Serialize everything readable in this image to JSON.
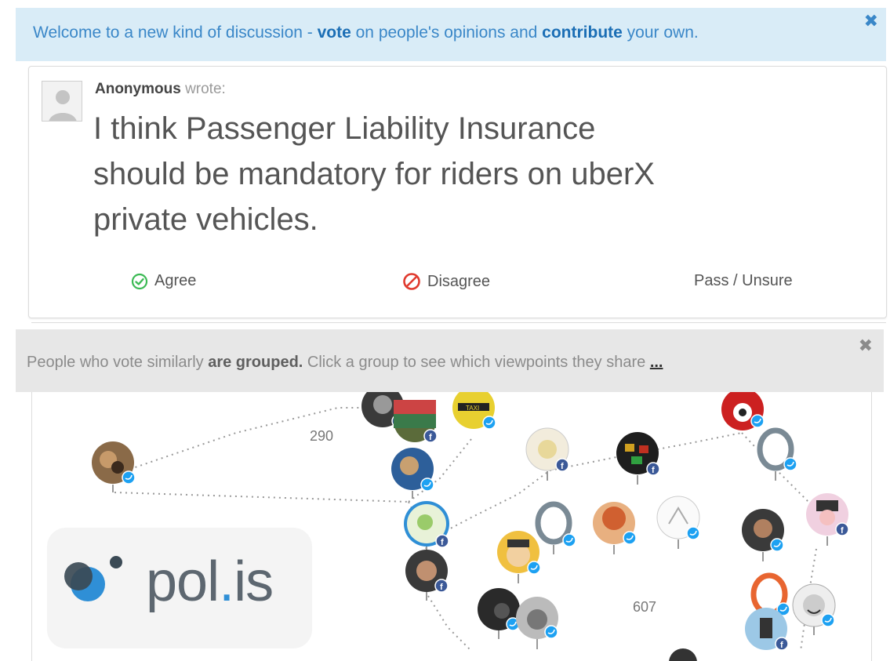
{
  "banner": {
    "prefix": "Welcome to a new kind of discussion - ",
    "vote": "vote",
    "middle": " on people's opinions and ",
    "contribute": "contribute",
    "suffix": " your own.",
    "close": "✖"
  },
  "comment": {
    "author": "Anonymous",
    "wrote": "wrote:",
    "lines": [
      "I think Passenger Liability Insurance",
      "should be mandatory for riders on uberX",
      "private vehicles."
    ]
  },
  "votes": {
    "agree": "Agree",
    "disagree": "Disagree",
    "pass": "Pass / Unsure"
  },
  "group_banner": {
    "prefix": "People who vote similarly ",
    "bold": "are grouped.",
    "suffix": " Click a group to see which viewpoints they share ",
    "more": "...",
    "close": "✖"
  },
  "groups": [
    {
      "count": "290"
    },
    {
      "count": "607"
    }
  ],
  "logo": {
    "text_a": "pol",
    "dot": ".",
    "text_b": "is"
  },
  "colors": {
    "accent": "#2f8fd6",
    "agree": "#3cba54",
    "disagree": "#e03a2e",
    "twitter": "#1da1f2",
    "facebook": "#3b5998"
  }
}
